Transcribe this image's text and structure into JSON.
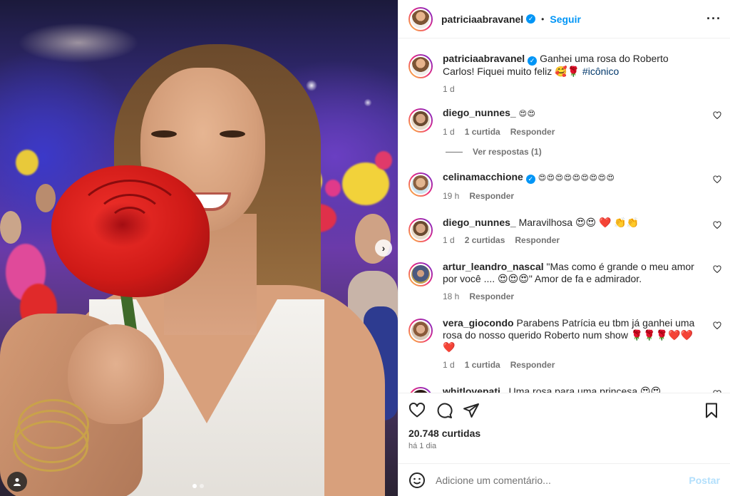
{
  "header": {
    "username": "patriciaabravanel",
    "follow_label": "Seguir",
    "more_icon": "more-horizontal-icon"
  },
  "caption": {
    "username": "patriciaabravanel",
    "text": "Ganhei uma rosa do Roberto Carlos! Fiquei muito feliz 🥰🌹",
    "hashtag": "#icônico",
    "time": "1 d"
  },
  "comments": [
    {
      "username": "diego_nunnes_",
      "text": "😍😍",
      "time": "1 d",
      "likes": "1 curtida",
      "reply": "Responder",
      "view_replies": "Ver respostas (1)"
    },
    {
      "username": "celinamacchione",
      "verified": true,
      "text": "😍😍😍😍😍😍😍😍😍",
      "time": "19 h",
      "reply": "Responder"
    },
    {
      "username": "diego_nunnes_",
      "text": "Maravilhosa 😍😍 ❤️ 👏👏",
      "time": "1 d",
      "likes": "2 curtidas",
      "reply": "Responder"
    },
    {
      "username": "artur_leandro_nascal",
      "text": "\"Mas como é grande o meu amor por você .... 😍😍😍\" Amor de fa e admirador.",
      "time": "18 h",
      "reply": "Responder"
    },
    {
      "username": "vera_giocondo",
      "text": "Parabens Patrícia eu tbm já ganhei uma rosa do nosso querido Roberto num show 🌹🌹🌹❤️❤️❤️",
      "time": "1 d",
      "likes": "1 curtida",
      "reply": "Responder"
    },
    {
      "username": "whitlovepati_",
      "text": "Uma rosa para uma princesa 😍😍"
    }
  ],
  "footer": {
    "likes": "20.748 curtidas",
    "ago": "há 1 dia",
    "comment_placeholder": "Adicione um comentário...",
    "post_label": "Postar"
  },
  "colors": {
    "accent": "#0095f6",
    "text": "#262626",
    "secondary": "#737373",
    "hashtag": "#00376b",
    "post_disabled": "#b2dffc"
  },
  "carousel": {
    "current": 1,
    "total": 2
  }
}
